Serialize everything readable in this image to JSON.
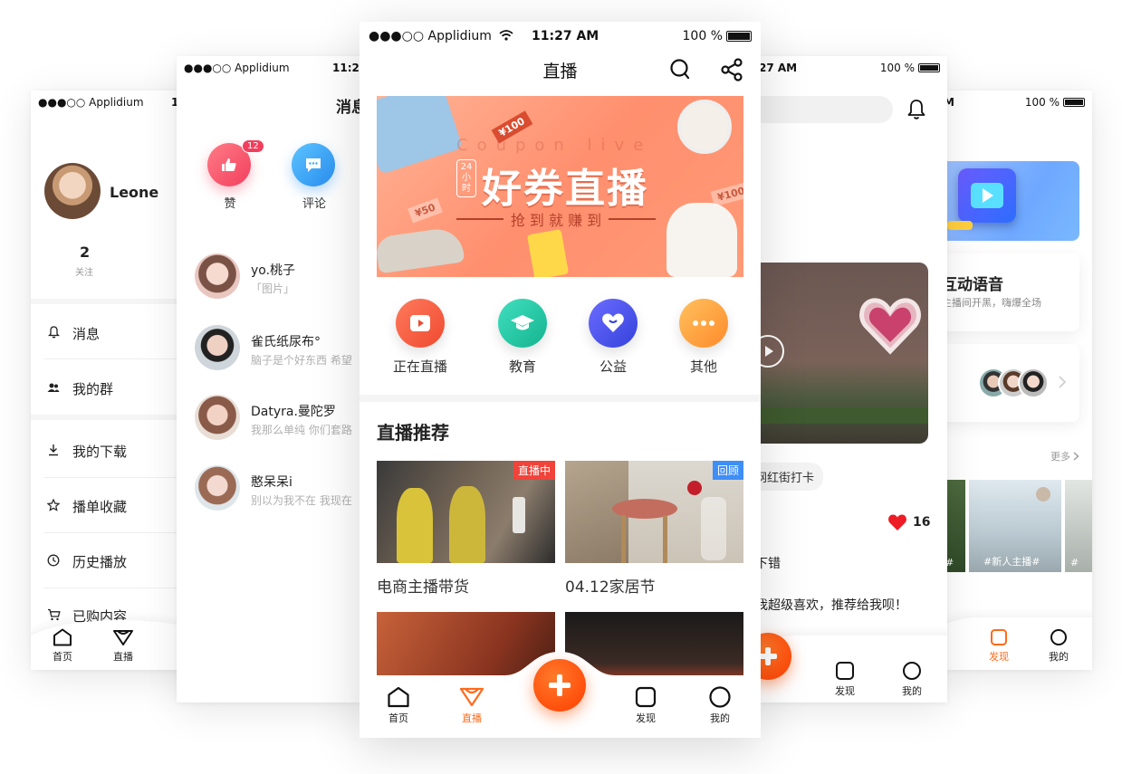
{
  "phone1": {
    "status": {
      "carrier": "●●●○○ Applidium",
      "time_partial": "1"
    },
    "profile": {
      "name": "Leone",
      "follow_count": "2",
      "follow_label": "关注"
    },
    "menu": [
      {
        "icon": "bell-icon",
        "label": "消息"
      },
      {
        "icon": "group-icon",
        "label": "我的群"
      },
      {
        "icon": "download-icon",
        "label": "我的下载"
      },
      {
        "icon": "star-icon",
        "label": "播单收藏"
      },
      {
        "icon": "clock-icon",
        "label": "历史播放"
      },
      {
        "icon": "cart-icon",
        "label": "已购内容"
      }
    ],
    "tabs": [
      {
        "label": "首页"
      },
      {
        "label": "直播"
      }
    ]
  },
  "phone2": {
    "status": {
      "carrier": "●●●○○ Applidium",
      "time_partial": "11:2"
    },
    "title_partial": "消息",
    "quick": [
      {
        "label": "赞",
        "badge": "12",
        "color": "#f5506a"
      },
      {
        "label": "评论",
        "color": "#35a8f5"
      }
    ],
    "messages": [
      {
        "name": "yo.桃子",
        "preview": "「图片」"
      },
      {
        "name": "雀氏纸尿布°",
        "preview": "脑子是个好东西 希望"
      },
      {
        "name": "Datyra.曼陀罗",
        "preview": "我那么单纯 你们套路"
      },
      {
        "name": "憨呆呆i",
        "preview": "别以为我不在 我现在"
      }
    ]
  },
  "phone3": {
    "status": {
      "carrier": "●●●○○ Applidium",
      "time": "11:27 AM",
      "battery": "100 %"
    },
    "title": "直播",
    "banner": {
      "title": "好券直播",
      "subtitle": "抢 到 就 赚 到",
      "badge_lines": [
        "24",
        "小",
        "时"
      ],
      "watermark": "Coupon live",
      "ticket1": "¥100",
      "ticket2": "¥100",
      "ticket3": "¥50"
    },
    "categories": [
      {
        "label": "正在直播",
        "icon": "play-icon",
        "color": "#f2553a"
      },
      {
        "label": "教育",
        "icon": "graduation-cap-icon",
        "color": "#22c8a6"
      },
      {
        "label": "公益",
        "icon": "heart-icon",
        "color": "#4a52e8"
      },
      {
        "label": "其他",
        "icon": "more-icon",
        "color": "#ff9a3c"
      }
    ],
    "section_title": "直播推荐",
    "cards": [
      {
        "title": "电商主播带货",
        "badge": "直播中",
        "badge_color": "#f0433a"
      },
      {
        "title": "04.12家居节",
        "badge": "回顾",
        "badge_color": "#3e8ef7"
      }
    ],
    "tabs": [
      {
        "label": "首页"
      },
      {
        "label": "直播"
      },
      {
        "label": "发现"
      },
      {
        "label": "我的"
      }
    ]
  },
  "phone4": {
    "status": {
      "time_partial": "27 AM",
      "battery": "100 %"
    },
    "tag": "网红街打卡",
    "likes": "16",
    "comment1": "下错",
    "comment2": "我超级喜欢，推荐给我呗！",
    "tabs": [
      {
        "label": "发现"
      },
      {
        "label": "我的"
      }
    ]
  },
  "phone5": {
    "status": {
      "time_partial": "M",
      "battery": "100 %"
    },
    "card_title": "互动语音",
    "card_sub": "主播间开黑，嗨爆全场",
    "more": "更多",
    "tiles": [
      "#",
      "#新人主播#",
      "#"
    ],
    "tabs": [
      {
        "label": "发现"
      },
      {
        "label": "我的"
      }
    ]
  }
}
